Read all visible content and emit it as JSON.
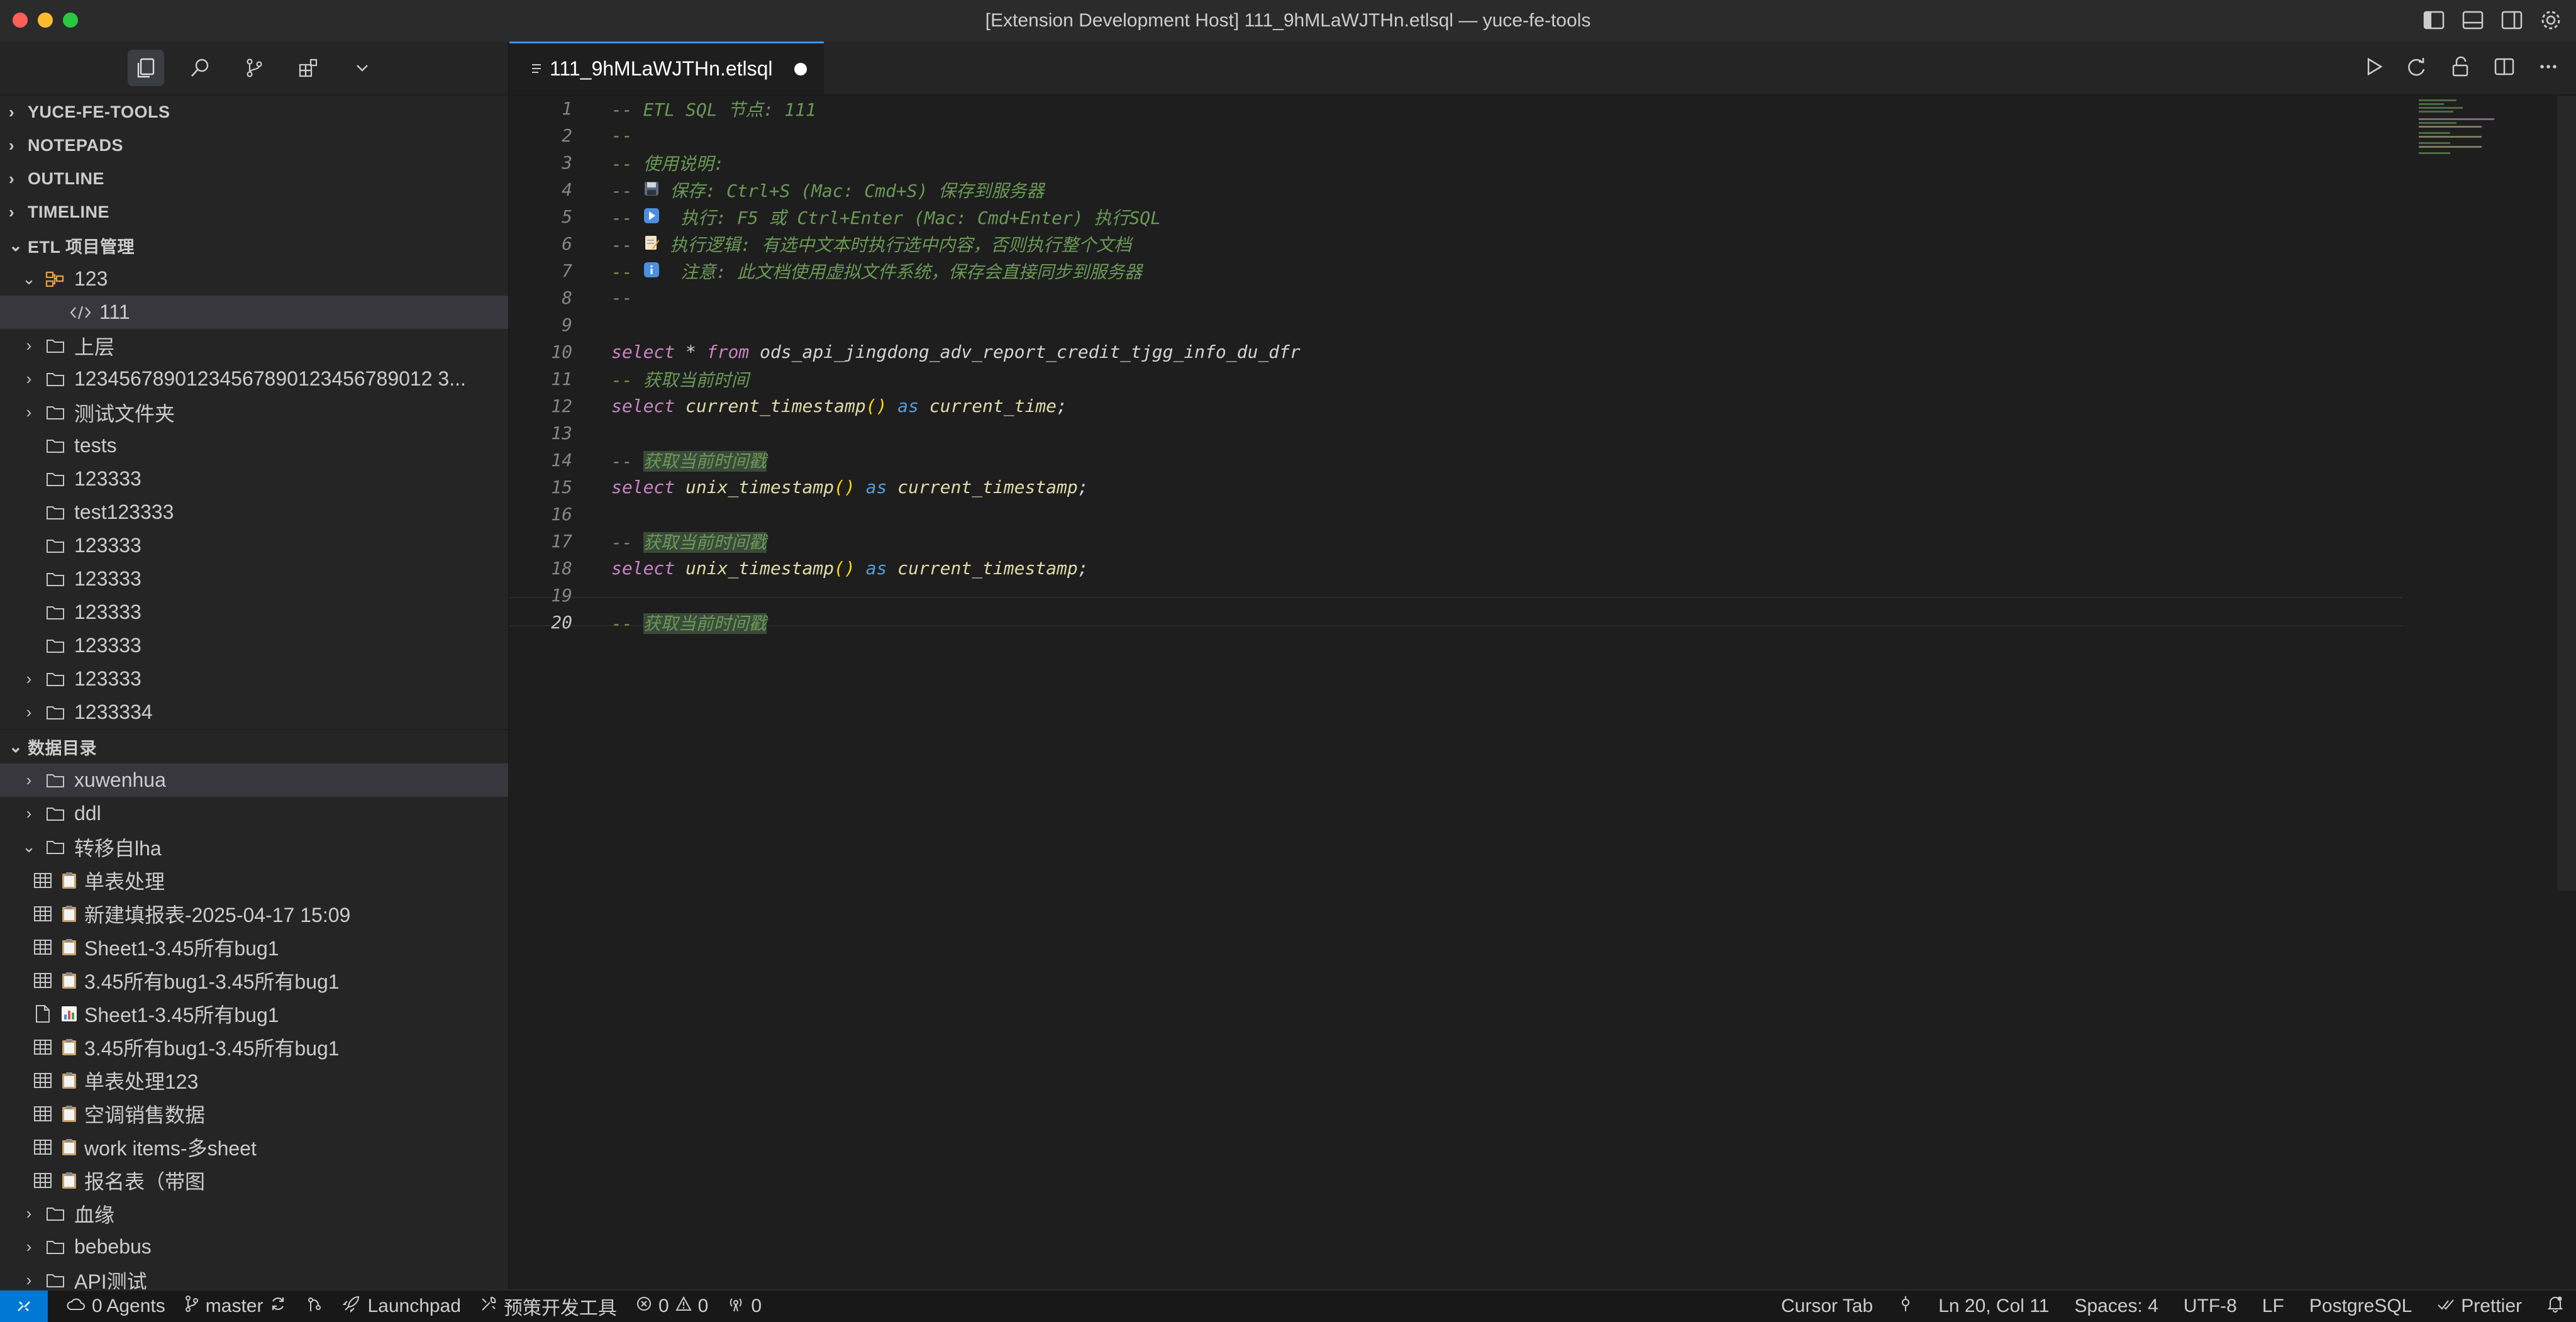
{
  "window": {
    "title": "[Extension Development Host] 111_9hMLaWJTHn.etlsql — yuce-fe-tools",
    "traffic_colors": [
      "#ff5f57",
      "#febc2e",
      "#28c840"
    ]
  },
  "sidebar": {
    "toolbar_icons": [
      "explorer-icon",
      "search-icon",
      "source-control-icon",
      "extensions-icon",
      "chevron-down-icon"
    ],
    "sections": {
      "yuce": "YUCE-FE-TOOLS",
      "notepads": "NOTEPADS",
      "outline": "OUTLINE",
      "timeline": "TIMELINE",
      "etl": "ETL 项目管理",
      "catalog": "数据目录"
    },
    "etl_items": [
      {
        "label": "123",
        "twisty": "open",
        "icon": "project-icon",
        "depth": 1
      },
      {
        "label": "111",
        "twisty": "",
        "icon": "code-icon",
        "depth": 2,
        "selected": true
      },
      {
        "label": "上层",
        "twisty": "closed",
        "icon": "folder-icon",
        "depth": 1
      },
      {
        "label": "12345678901234567890123456789012 3...",
        "twisty": "closed",
        "icon": "folder-icon",
        "depth": 1
      },
      {
        "label": "测试文件夹",
        "twisty": "closed",
        "icon": "folder-icon",
        "depth": 1
      },
      {
        "label": "tests",
        "twisty": "",
        "icon": "folder-icon",
        "depth": 1
      },
      {
        "label": "123333",
        "twisty": "",
        "icon": "folder-icon",
        "depth": 1
      },
      {
        "label": "test123333",
        "twisty": "",
        "icon": "folder-icon",
        "depth": 1
      },
      {
        "label": "123333",
        "twisty": "",
        "icon": "folder-icon",
        "depth": 1
      },
      {
        "label": "123333",
        "twisty": "",
        "icon": "folder-icon",
        "depth": 1
      },
      {
        "label": "123333",
        "twisty": "",
        "icon": "folder-icon",
        "depth": 1
      },
      {
        "label": "123333",
        "twisty": "",
        "icon": "folder-icon",
        "depth": 1
      },
      {
        "label": "123333",
        "twisty": "closed",
        "icon": "folder-icon",
        "depth": 1
      },
      {
        "label": "1233334",
        "twisty": "closed",
        "icon": "folder-icon",
        "depth": 1
      }
    ],
    "catalog_items": [
      {
        "label": "xuwenhua",
        "twisty": "closed",
        "icon": "folder-icon",
        "selected": true
      },
      {
        "label": "ddl",
        "twisty": "closed",
        "icon": "folder-icon"
      },
      {
        "label": "转移自lha",
        "twisty": "open",
        "icon": "folder-icon"
      },
      {
        "label": "单表处理",
        "icon": "table-icon",
        "emoji": "clipboard"
      },
      {
        "label": "新建填报表-2025-04-17 15:09",
        "icon": "table-icon",
        "emoji": "clipboard"
      },
      {
        "label": "Sheet1-3.45所有bug1",
        "icon": "table-icon",
        "emoji": "clipboard"
      },
      {
        "label": "3.45所有bug1-3.45所有bug1",
        "icon": "table-icon",
        "emoji": "clipboard"
      },
      {
        "label": "Sheet1-3.45所有bug1",
        "icon": "file-icon",
        "emoji": "chart"
      },
      {
        "label": "3.45所有bug1-3.45所有bug1",
        "icon": "table-icon",
        "emoji": "clipboard"
      },
      {
        "label": "单表处理123",
        "icon": "table-icon",
        "emoji": "clipboard"
      },
      {
        "label": "空调销售数据",
        "icon": "table-icon",
        "emoji": "clipboard"
      },
      {
        "label": "work items-多sheet",
        "icon": "table-icon",
        "emoji": "clipboard"
      },
      {
        "label": "报名表（带图",
        "icon": "table-icon",
        "emoji": "clipboard"
      },
      {
        "label": "血缘",
        "twisty": "closed",
        "icon": "folder-icon"
      },
      {
        "label": "bebebus",
        "twisty": "closed",
        "icon": "folder-icon"
      },
      {
        "label": "API测试",
        "twisty": "closed",
        "icon": "folder-icon"
      }
    ]
  },
  "editor": {
    "tab_label": "111_9hMLaWJTHn.etlsql",
    "tab_dirty": true,
    "line_numbers": [
      "1",
      "2",
      "3",
      "4",
      "5",
      "6",
      "7",
      "8",
      "9",
      "10",
      "11",
      "12",
      "13",
      "14",
      "15",
      "16",
      "17",
      "18",
      "19",
      "20"
    ],
    "lines": {
      "l1": "-- ETL SQL 节点: 111",
      "l2": "--",
      "l3": "-- 使用说明:",
      "l4a": "-- ",
      "l4b": " 保存: Ctrl+S (Mac: Cmd+S) 保存到服务器",
      "l5a": "-- ",
      "l5b": "  执行: F5 或 Ctrl+Enter (Mac: Cmd+Enter) 执行SQL",
      "l6a": "-- ",
      "l6b": " 执行逻辑: 有选中文本时执行选中内容，否则执行整个文档",
      "l7a": "-- ",
      "l7b": "  注意: 此文档使用虚拟文件系统，保存会直接同步到服务器",
      "l8": "--",
      "l10_kw1": "select",
      "l10_star": " * ",
      "l10_kw2": "from",
      "l10_tbl": " ods_api_jingdong_adv_report_credit_tjgg_info_du_dfr",
      "l11": "-- 获取当前时间",
      "l12_kw": "select",
      "l12_fn": " current_timestamp",
      "l12_p": "()",
      "l12_as": " as",
      "l12_alias": " current_time",
      "l12_end": ";",
      "l14_prefix": "-- ",
      "l14_hl": "获取当前时间戳",
      "l15_kw": "select",
      "l15_fn": " unix_timestamp",
      "l15_p": "()",
      "l15_as": " as",
      "l15_alias": " current_timestamp",
      "l15_end": ";",
      "l17_prefix": "-- ",
      "l17_hl": "获取当前时间戳",
      "l18_kw": "select",
      "l18_fn": " unix_timestamp",
      "l18_p": "()",
      "l18_as": " as",
      "l18_alias": " current_timestamp",
      "l18_end": ";",
      "l20_prefix": "-- ",
      "l20_hl": "获取当前时间戳"
    },
    "current_line": 20
  },
  "statusbar": {
    "agents": "0 Agents",
    "branch": "master",
    "launchpad": "Launchpad",
    "tools": "预策开发工具",
    "errors": "0",
    "warnings": "0",
    "ports": "0",
    "cursor_tab": "Cursor Tab",
    "position": "Ln 20, Col 11",
    "spaces": "Spaces: 4",
    "encoding": "UTF-8",
    "eol": "LF",
    "language": "PostgreSQL",
    "prettier": "Prettier"
  },
  "colors": {
    "accent": "#0078d4",
    "tab_border": "#3794ff",
    "comment": "#6a9955",
    "keyword": "#c586c0",
    "function": "#dcdcaa"
  }
}
